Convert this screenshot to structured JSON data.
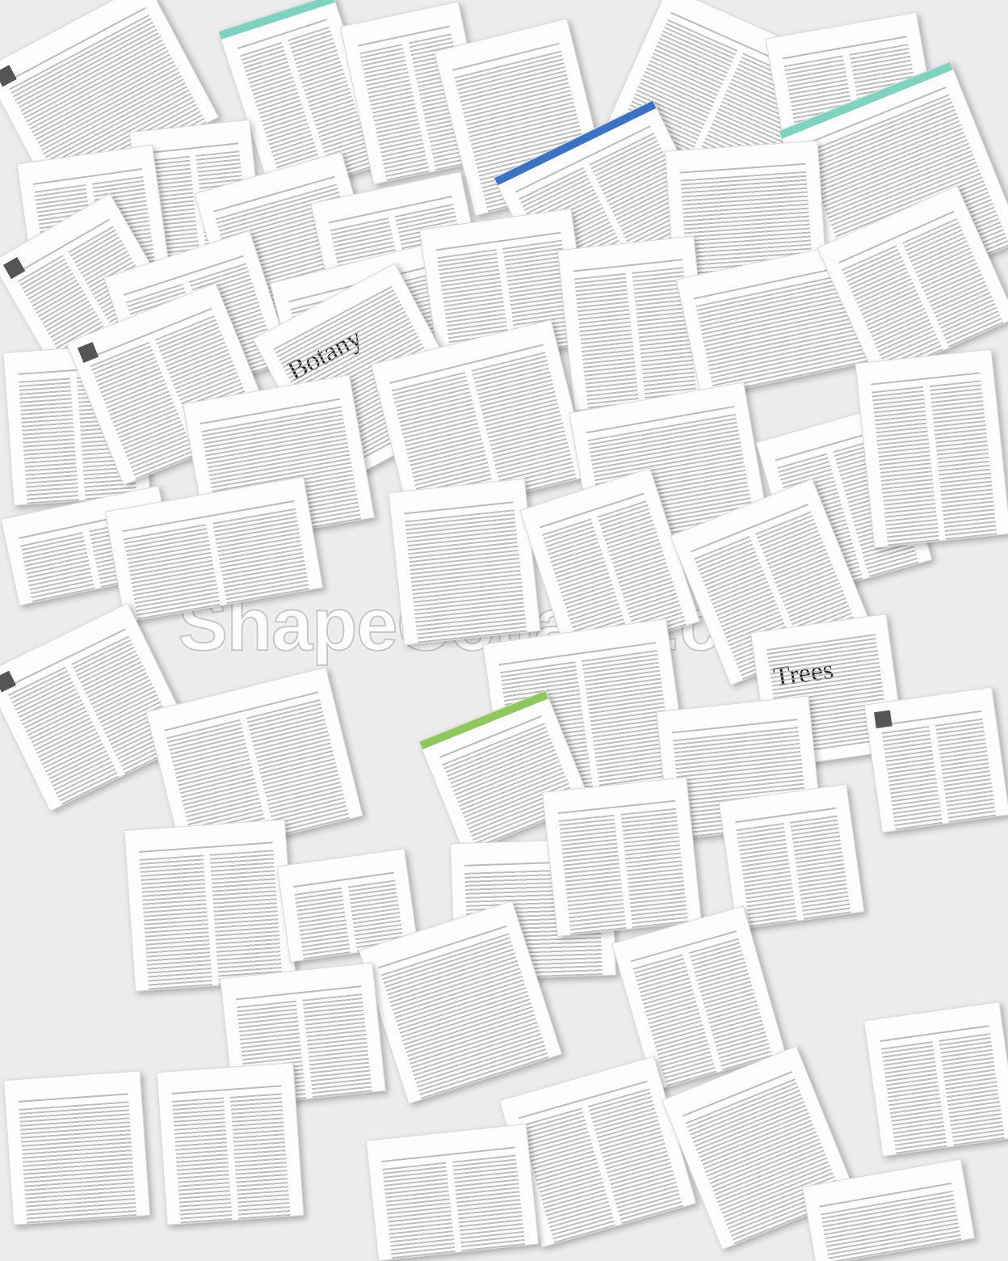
{
  "watermark": "ShapeCollage.com",
  "colors": {
    "background": "#ececec",
    "paper": "#fdfdfd",
    "accent_teal": "#7dd3c0",
    "accent_blue": "#3b73c4",
    "accent_green": "#8fc85a"
  },
  "pages": [
    {
      "title": "",
      "banner": "",
      "logo": "dark"
    },
    {
      "title": "",
      "banner": "teal",
      "logo": ""
    },
    {
      "title": "",
      "banner": "",
      "logo": ""
    },
    {
      "title": "",
      "banner": "",
      "logo": ""
    },
    {
      "title": "",
      "banner": "",
      "logo": ""
    },
    {
      "title": "",
      "banner": "",
      "logo": ""
    },
    {
      "title": "",
      "banner": "teal",
      "logo": ""
    },
    {
      "title": "",
      "banner": "",
      "logo": ""
    },
    {
      "title": "",
      "banner": "",
      "logo": ""
    },
    {
      "title": "",
      "banner": "",
      "logo": ""
    },
    {
      "title": "",
      "banner": "",
      "logo": ""
    },
    {
      "title": "",
      "banner": "blue",
      "logo": ""
    },
    {
      "title": "",
      "banner": "",
      "logo": ""
    },
    {
      "title": "",
      "banner": "",
      "logo": "dark"
    },
    {
      "title": "",
      "banner": "",
      "logo": ""
    },
    {
      "title": "",
      "banner": "",
      "logo": ""
    },
    {
      "title": "",
      "banner": "",
      "logo": ""
    },
    {
      "title": "",
      "banner": "",
      "logo": ""
    },
    {
      "title": "",
      "banner": "",
      "logo": ""
    },
    {
      "title": "",
      "banner": "",
      "logo": ""
    },
    {
      "title": "",
      "banner": "",
      "logo": ""
    },
    {
      "title": "Botany",
      "banner": "",
      "logo": "",
      "journal": true
    },
    {
      "title": "",
      "banner": "",
      "logo": "dark"
    },
    {
      "title": "",
      "banner": "",
      "logo": ""
    },
    {
      "title": "",
      "banner": "",
      "logo": ""
    },
    {
      "title": "",
      "banner": "",
      "logo": ""
    },
    {
      "title": "",
      "banner": "",
      "logo": ""
    },
    {
      "title": "",
      "banner": "",
      "logo": ""
    },
    {
      "title": "",
      "banner": "",
      "logo": ""
    },
    {
      "title": "",
      "banner": "",
      "logo": ""
    },
    {
      "title": "",
      "banner": "",
      "logo": ""
    },
    {
      "title": "",
      "banner": "",
      "logo": ""
    },
    {
      "title": "",
      "banner": "",
      "logo": ""
    },
    {
      "title": "Trees",
      "banner": "",
      "logo": "",
      "journal": true
    },
    {
      "title": "",
      "banner": "",
      "logo": "dark"
    },
    {
      "title": "",
      "banner": "",
      "logo": ""
    },
    {
      "title": "",
      "banner": "green",
      "logo": ""
    },
    {
      "title": "",
      "banner": "",
      "logo": ""
    },
    {
      "title": "",
      "banner": "",
      "logo": "dark"
    },
    {
      "title": "",
      "banner": "",
      "logo": ""
    },
    {
      "title": "",
      "banner": "",
      "logo": ""
    },
    {
      "title": "",
      "banner": "",
      "logo": ""
    },
    {
      "title": "",
      "banner": "",
      "logo": ""
    },
    {
      "title": "",
      "banner": "",
      "logo": ""
    },
    {
      "title": "",
      "banner": "",
      "logo": ""
    },
    {
      "title": "",
      "banner": "",
      "logo": ""
    },
    {
      "title": "",
      "banner": "",
      "logo": ""
    },
    {
      "title": "",
      "banner": "",
      "logo": ""
    },
    {
      "title": "",
      "banner": "",
      "logo": ""
    },
    {
      "title": "",
      "banner": "",
      "logo": ""
    },
    {
      "title": "",
      "banner": "",
      "logo": ""
    },
    {
      "title": "",
      "banner": "",
      "logo": ""
    },
    {
      "title": "",
      "banner": "",
      "logo": ""
    },
    {
      "title": "",
      "banner": "",
      "logo": ""
    },
    {
      "title": "",
      "banner": "",
      "logo": ""
    }
  ]
}
